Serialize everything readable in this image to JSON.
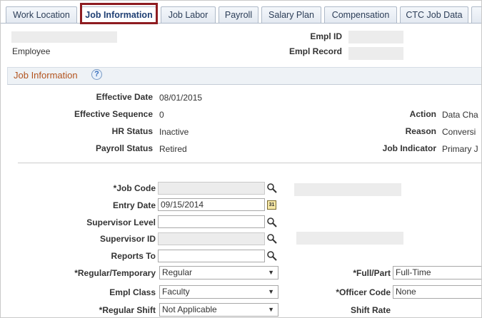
{
  "tabs": [
    {
      "label": "Work Location"
    },
    {
      "label": "Job Information"
    },
    {
      "label": "Job Labor"
    },
    {
      "label": "Payroll"
    },
    {
      "label": "Salary Plan"
    },
    {
      "label": "Compensation"
    },
    {
      "label": "CTC Job Data"
    }
  ],
  "active_tab": "Job Information",
  "header": {
    "employee_label": "Employee",
    "empl_id_label": "Empl ID",
    "empl_record_label": "Empl Record"
  },
  "section": {
    "title": "Job Information",
    "help_icon": "help-icon"
  },
  "info": {
    "effective_date_label": "Effective Date",
    "effective_date": "08/01/2015",
    "effective_seq_label": "Effective Sequence",
    "effective_seq": "0",
    "hr_status_label": "HR Status",
    "hr_status": "Inactive",
    "payroll_status_label": "Payroll Status",
    "payroll_status": "Retired",
    "action_label": "Action",
    "action": "Data Cha",
    "reason_label": "Reason",
    "reason": "Conversi",
    "job_indicator_label": "Job Indicator",
    "job_indicator": "Primary J"
  },
  "form": {
    "job_code_label": "*Job Code",
    "job_code": "",
    "entry_date_label": "Entry Date",
    "entry_date": "09/15/2014",
    "supervisor_level_label": "Supervisor Level",
    "supervisor_level": "",
    "supervisor_id_label": "Supervisor ID",
    "supervisor_id": "",
    "reports_to_label": "Reports To",
    "reports_to": "",
    "reg_temp_label": "*Regular/Temporary",
    "reg_temp": "Regular",
    "empl_class_label": "Empl Class",
    "empl_class": "Faculty",
    "regular_shift_label": "*Regular Shift",
    "regular_shift": "Not Applicable",
    "full_part_label": "*Full/Part",
    "full_part": "Full-Time",
    "officer_code_label": "*Officer Code",
    "officer_code": "None",
    "shift_rate_label": "Shift Rate"
  },
  "colors": {
    "section_title": "#b2531e",
    "tab_text": "#2b3d57",
    "highlight": "#8e1c20"
  }
}
